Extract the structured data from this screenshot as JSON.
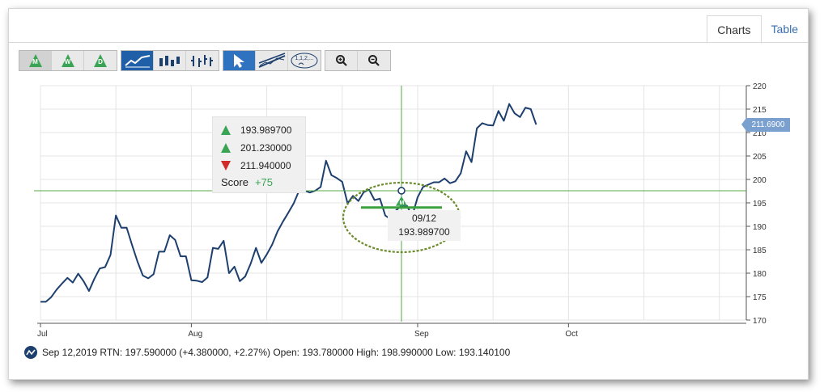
{
  "tabs": [
    {
      "label": "Charts",
      "active": true
    },
    {
      "label": "Table",
      "active": false
    }
  ],
  "toolbar": {
    "signal_buttons": [
      {
        "letter": "M",
        "name": "monthly-signal-button"
      },
      {
        "letter": "W",
        "name": "weekly-signal-button"
      },
      {
        "letter": "D",
        "name": "daily-signal-button"
      }
    ],
    "zoom_in_icon": "zoom-in-icon",
    "zoom_out_icon": "zoom-out-icon",
    "sequence_label": "1,1,2,..."
  },
  "tooltip": {
    "rows": [
      {
        "letter": "M",
        "value": "193.989700",
        "direction": "up"
      },
      {
        "letter": "W",
        "value": "201.230000",
        "direction": "up"
      },
      {
        "letter": "D",
        "value": "211.940000",
        "direction": "down"
      }
    ],
    "score_label": "Score",
    "score_value": "+75"
  },
  "point_label": {
    "date": "09/12",
    "value": "193.989700",
    "marker_letter": "M"
  },
  "last_price": "211.6900",
  "status": {
    "text": "Sep 12,2019 RTN: 197.590000 (+4.380000, +2.27%) Open: 193.780000 High: 198.990000 Low: 193.140100"
  },
  "colors": {
    "line": "#1d3f6e",
    "crosshair": "#55a845",
    "up": "#3aa455",
    "down": "#d02a2a",
    "circle": "#6b8a2a",
    "accent_blue": "#1f5fa8"
  },
  "chart_data": {
    "type": "line",
    "ylim": [
      170,
      220
    ],
    "yticks": [
      170,
      175,
      180,
      185,
      190,
      195,
      200,
      205,
      210,
      215,
      220
    ],
    "x_range": [
      0,
      131
    ],
    "xticks": [
      {
        "label": "Jul",
        "x": 0
      },
      {
        "label": "Aug",
        "x": 28
      },
      {
        "label": "Sep",
        "x": 70
      },
      {
        "label": "Oct",
        "x": 98
      }
    ],
    "crosshair": {
      "x": 67,
      "y": 197.59
    },
    "marker_level": 194.0,
    "grid": true,
    "values": [
      173.9,
      173.9,
      174.9,
      176.5,
      177.8,
      179.0,
      178.0,
      179.9,
      178.3,
      176.2,
      178.8,
      181.0,
      181.3,
      183.9,
      192.3,
      189.7,
      189.7,
      186.0,
      182.5,
      179.5,
      178.9,
      179.8,
      184.6,
      184.6,
      188.1,
      187.1,
      183.6,
      183.6,
      178.5,
      178.4,
      178.1,
      179.1,
      185.4,
      185.2,
      186.9,
      180.0,
      181.4,
      178.3,
      179.3,
      182.0,
      185.4,
      182.2,
      184.0,
      186.1,
      188.9,
      191.0,
      192.9,
      194.9,
      197.6,
      197.6,
      197.2,
      197.6,
      198.4,
      204.0,
      200.9,
      200.3,
      199.5,
      194.9,
      196.5,
      195.4,
      197.3,
      197.8,
      195.6,
      195.9,
      192.3,
      191.5,
      193.4,
      194.4,
      194.4,
      192.2,
      196.2,
      198.4,
      198.9,
      199.4,
      199.4,
      200.2,
      199.2,
      199.6,
      201.3,
      206.0,
      203.7,
      210.9,
      212.0,
      211.6,
      211.5,
      214.6,
      212.5,
      216.1,
      214.1,
      213.3,
      215.3,
      215.0,
      211.7
    ]
  }
}
